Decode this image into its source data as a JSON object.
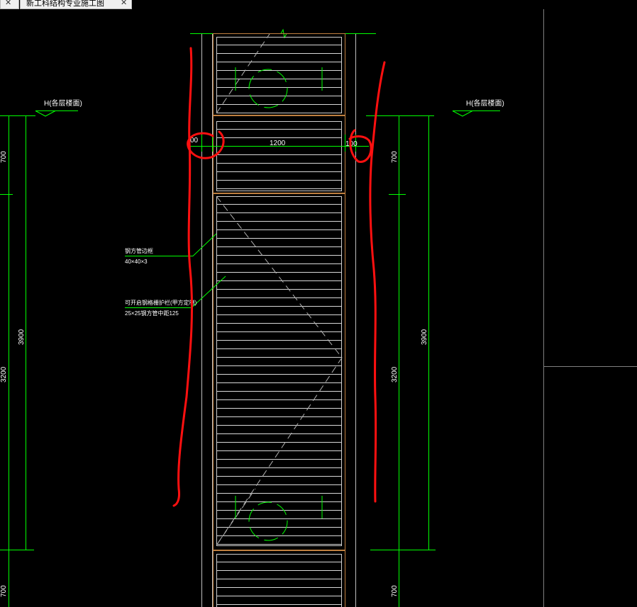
{
  "tabs": [
    {
      "label": "",
      "close": "✕"
    },
    {
      "label": "新工科结构专业施工图",
      "close": "✕"
    }
  ],
  "drawing": {
    "floor_label_left": "H(各层楼面)",
    "floor_label_right": "H(各层楼面)",
    "dim_width_center": "1200",
    "dim_width_left_partial": "00",
    "dim_width_right_partial": "100",
    "dim_left_top": "700",
    "dim_left_mid": "3200",
    "dim_left_total": "3900",
    "dim_left_bottom": "700",
    "dim_right_top": "700",
    "dim_right_mid": "3200",
    "dim_right_total": "3900",
    "dim_right_bottom": "700",
    "note1_line1": "钢方管边框",
    "note1_line2": "40×40×3",
    "note2_line1": "可开启钢格栅护栏(甲方定制)",
    "note2_line2": "25×25钢方管中距125"
  },
  "colors": {
    "background": "#000000",
    "dim_green": "#00ff00",
    "frame_orange": "#c08040",
    "bar_white": "#e0e0e0",
    "annotation_red": "#ff1010",
    "border_gray": "#808080"
  }
}
